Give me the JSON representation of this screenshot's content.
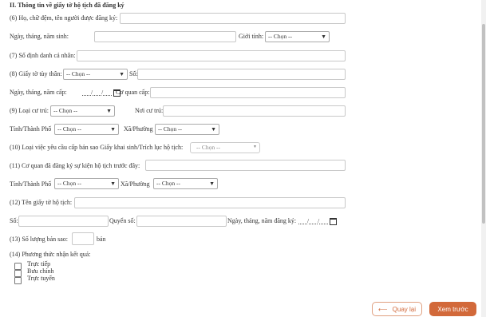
{
  "section": {
    "title": "II. Thông tin về giấy tờ hộ tịch đã đăng ký"
  },
  "fields": {
    "f6_label": "(6) Họ, chữ đệm, tên người được đăng ký:",
    "dob_label": "Ngày, tháng, năm sinh:",
    "gender_label": "Giới tính:",
    "f7_label": "(7) Số định danh cá nhân:",
    "f8_label": "(8) Giấy tờ tùy thân:",
    "so_label": "Số:",
    "issue_date_label": "Ngày, tháng, năm cấp:",
    "issuer_label": "Cơ quan cấp:",
    "f9_label": "(9) Loại cư trú:",
    "residence_label": "Nơi cư trú:",
    "province_label": "Tỉnh/Thành Phố",
    "ward_label": "Xã/Phường",
    "f10_label": "(10) Loại việc yêu cầu cấp bản sao Giấy khai sinh/Trích lục hộ tịch:",
    "f11_label": "(11) Cơ quan đã đăng ký sự kiện hộ tịch trước đây:",
    "province2_label": "Tỉnh/Thành Phố",
    "ward2_label": "Xã/Phường",
    "f12_label": "(12) Tên giấy tờ hộ tịch:",
    "so2_label": "Số:",
    "book_label": "Quyển số:",
    "reg_date_label": "Ngày, tháng, năm đăng ký:",
    "f13_label": "(13) Số lượng bản sao:",
    "copies_unit": "bản",
    "f14_label": "(14) Phương thức nhận kết quả:"
  },
  "selects": {
    "default": "-- Chọn --"
  },
  "date": {
    "sep": "/"
  },
  "delivery_options": [
    "Trực tiếp",
    "Bưu chính",
    "Trực tuyến"
  ],
  "buttons": {
    "back_label": "Quay lại",
    "back_arrow": "⟵",
    "next_label": "Xem trước"
  }
}
